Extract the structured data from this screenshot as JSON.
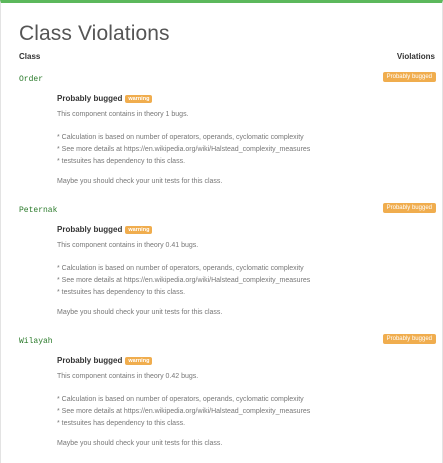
{
  "title": "Class Violations",
  "columns": {
    "class": "Class",
    "violations": "Violations"
  },
  "rows": [
    {
      "name": "Order",
      "badge": "Probably bugged",
      "bug_title": "Probably bugged",
      "warning": "warning",
      "summary": "This component contains in theory 1 bugs.",
      "note1": "* Calculation is based on number of operators, operands, cyclomatic complexity",
      "note2": "* See more details at https://en.wikipedia.org/wiki/Halstead_complexity_measures",
      "note3": "* testsuites has dependency to this class.",
      "advice": "Maybe you should check your unit tests for this class."
    },
    {
      "name": "Peternak",
      "badge": "Probably bugged",
      "bug_title": "Probably bugged",
      "warning": "warning",
      "summary": "This component contains in theory 0.41 bugs.",
      "note1": "* Calculation is based on number of operators, operands, cyclomatic complexity",
      "note2": "* See more details at https://en.wikipedia.org/wiki/Halstead_complexity_measures",
      "note3": "* testsuites has dependency to this class.",
      "advice": "Maybe you should check your unit tests for this class."
    },
    {
      "name": "Wilayah",
      "badge": "Probably bugged",
      "bug_title": "Probably bugged",
      "warning": "warning",
      "summary": "This component contains in theory 0.42 bugs.",
      "note1": "* Calculation is based on number of operators, operands, cyclomatic complexity",
      "note2": "* See more details at https://en.wikipedia.org/wiki/Halstead_complexity_measures",
      "note3": "* testsuites has dependency to this class.",
      "advice": "Maybe you should check your unit tests for this class."
    }
  ]
}
